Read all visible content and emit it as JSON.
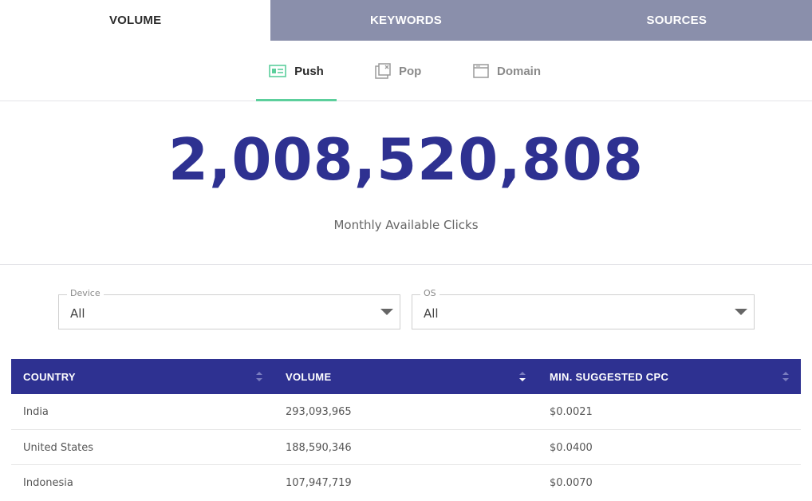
{
  "top_tabs": [
    {
      "label": "VOLUME",
      "active": true
    },
    {
      "label": "KEYWORDS",
      "active": false
    },
    {
      "label": "SOURCES",
      "active": false
    }
  ],
  "sub_tabs": [
    {
      "label": "Push",
      "icon": "push-ad-icon",
      "active": true
    },
    {
      "label": "Pop",
      "icon": "popup-window-icon",
      "active": false
    },
    {
      "label": "Domain",
      "icon": "browser-window-icon",
      "active": false
    }
  ],
  "hero": {
    "number": "2,008,520,808",
    "label": "Monthly Available Clicks"
  },
  "filters": {
    "device": {
      "label": "Device",
      "value": "All"
    },
    "os": {
      "label": "OS",
      "value": "All"
    }
  },
  "table": {
    "headers": [
      "COUNTRY",
      "VOLUME",
      "MIN. SUGGESTED CPC"
    ],
    "rows": [
      [
        "India",
        "293,093,965",
        "$0.0021"
      ],
      [
        "United States",
        "188,590,346",
        "$0.0400"
      ],
      [
        "Indonesia",
        "107,947,719",
        "$0.0070"
      ]
    ]
  },
  "colors": {
    "accent": "#2e3191",
    "tab_inactive_bg": "#8a8fab",
    "active_underline": "#5ccf9c"
  }
}
